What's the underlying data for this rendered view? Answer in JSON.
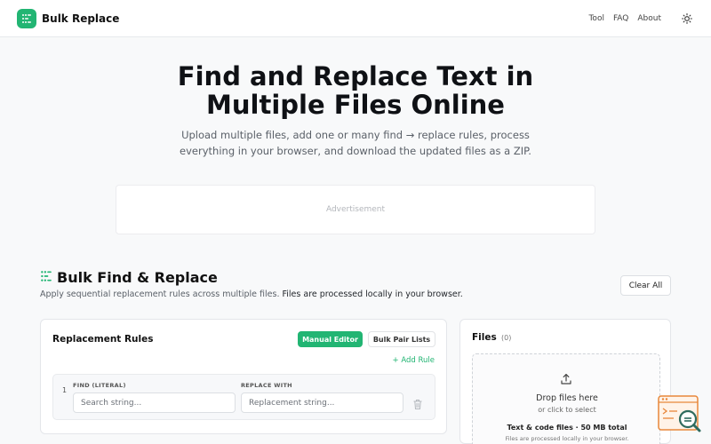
{
  "header": {
    "brand": "Bulk Replace",
    "nav": [
      "Tool",
      "FAQ",
      "About"
    ],
    "theme_icon": "sun-icon",
    "logo_icon": "replace-logo-icon"
  },
  "hero": {
    "title_line1": "Find and Replace Text in",
    "title_line2": "Multiple Files Online",
    "subtitle_line1": "Upload multiple files, add one or many find → replace rules, process",
    "subtitle_line2": "everything in your browser, and download the updated files as a ZIP."
  },
  "ad": {
    "label": "Advertisement"
  },
  "tool": {
    "title": "Bulk Find & Replace",
    "description": "Apply sequential replacement rules across multiple files.",
    "description_strong": "Files are processed locally in your browser.",
    "clear_label": "Clear All"
  },
  "rules": {
    "title": "Replacement Rules",
    "mode_manual": "Manual Editor",
    "mode_bulk": "Bulk Pair Lists",
    "add_rule": "+ Add Rule",
    "row": {
      "number": "1",
      "find_label": "FIND (LITERAL)",
      "replace_label": "REPLACE WITH",
      "find_placeholder": "Search string...",
      "replace_placeholder": "Replacement string..."
    }
  },
  "files": {
    "title": "Files",
    "count": "(0)",
    "drop_main": "Drop files here",
    "drop_sub": "or click to select",
    "limit": "Text & code files · 50 MB total",
    "note": "Files are processed locally in your browser."
  },
  "colors": {
    "accent": "#22b573",
    "widget": "#e8873a"
  }
}
